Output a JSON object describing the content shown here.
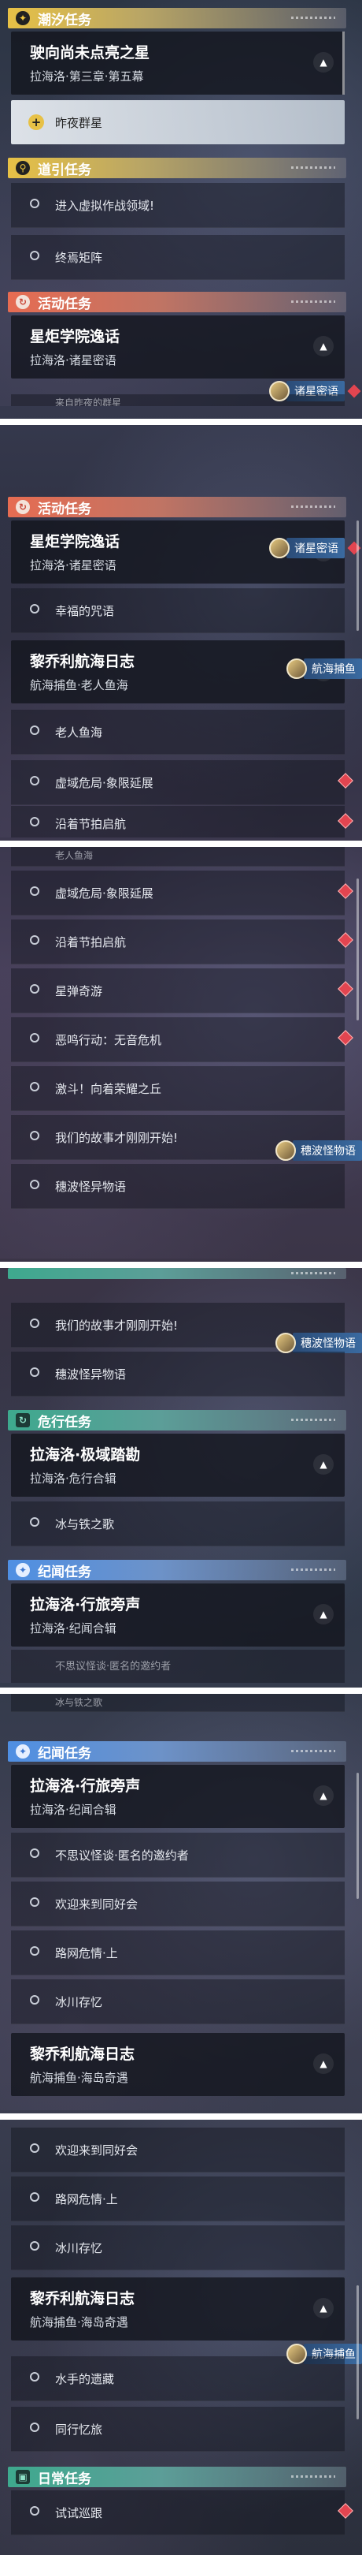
{
  "categories": {
    "tide": "潮汐任务",
    "guide": "道引任务",
    "activity": "活动任务",
    "danger": "危行任务",
    "chronicle": "纪闻任务",
    "daily": "日常任务"
  },
  "quests": {
    "lights": {
      "title": "驶向尚未点亮之星",
      "subtitle": "拉海洛·第三章·第五幕"
    },
    "academy": {
      "title": "星炬学院逸话",
      "subtitle": "拉海洛·诸星密语"
    },
    "log": {
      "title": "黎乔利航海日志",
      "subtitle_old_man": "航海捕鱼·老人鱼海",
      "subtitle_island": "航海捕鱼·海岛奇遇"
    },
    "polar": {
      "title": "拉海洛·极域踏勘",
      "subtitle": "拉海洛·危行合辑"
    },
    "travel": {
      "title": "拉海洛·行旅旁声",
      "subtitle": "拉海洛·纪闻合辑"
    }
  },
  "tasks": {
    "night_stars": "昨夜群星",
    "enter_virtual": "进入虚拟作战领域!",
    "end_matrix": "终焉矩阵",
    "yesterday_partial": "来自昨夜的群星",
    "blessing": "幸福的咒语",
    "old_man_sea": "老人鱼海",
    "hollow_danger": "虚域危局·象限延展",
    "sail_voyage": "沿着节拍启航",
    "star_bullet": "星弹奇游",
    "terror": "恶鸣行动：无音危机",
    "glory": "激斗！向着荣耀之丘",
    "story": "我们的故事才刚刚开始!",
    "whale_story": "穗波怪异物语",
    "ice_fire": "冰与铁之歌",
    "invitation": "不思议怪谈·匿名的邀约者",
    "welcome": "欢迎来到同好会",
    "road_danger": "路网危情·上",
    "ice_memory": "冰川存忆",
    "water_jump": "水手的遗藏",
    "travel_memory": "同行忆旅",
    "trial_patrol": "试试巡跟"
  },
  "tags": {
    "stars_secret": "诸星密语",
    "sea_fishing": "航海捕鱼",
    "wave_story": "穗波怪物语"
  }
}
